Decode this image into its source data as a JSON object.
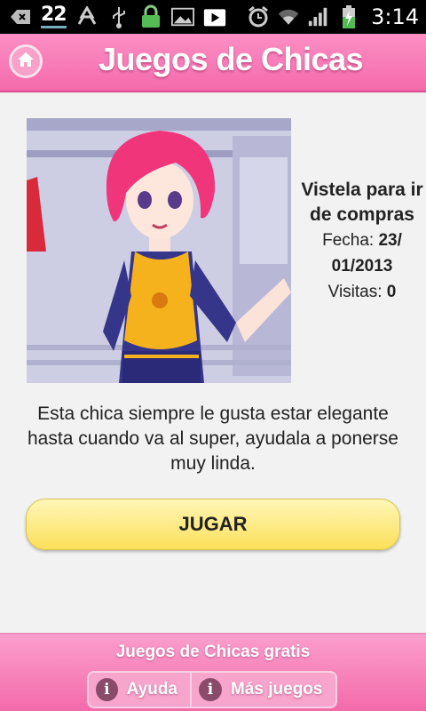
{
  "status_bar": {
    "notification_count": "22",
    "time": "3:14",
    "icons": [
      "back-icon",
      "recycle-icon",
      "usb-icon",
      "lock-icon",
      "image-icon",
      "play-store-icon",
      "alarm-icon",
      "wifi-icon",
      "signal-icon",
      "battery-icon"
    ]
  },
  "header": {
    "title": "Juegos de Chicas",
    "home_icon": "home-icon"
  },
  "game": {
    "title": "Vistela para ir de compras",
    "date_label": "Fecha:",
    "date_value": "23/ 01/2013",
    "visits_label": "Visitas:",
    "visits_value": "0",
    "description": "Esta chica siempre le gusta estar elegante hasta cuando va al super, ayudala a ponerse muy linda."
  },
  "play_button": {
    "label": "JUGAR"
  },
  "footer": {
    "title": "Juegos de Chicas gratis",
    "help_label": "Ayuda",
    "more_label": "Más juegos"
  },
  "colors": {
    "header_pink": "#f56aab",
    "button_yellow": "#fbe05a",
    "status_bar": "#000000"
  }
}
